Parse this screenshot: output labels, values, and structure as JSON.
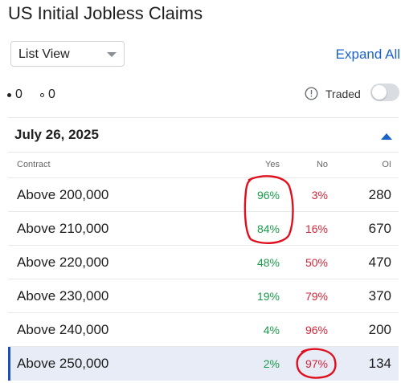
{
  "page": {
    "title": "US Initial Jobless Claims"
  },
  "controls": {
    "view_select": "List View",
    "expand_all": "Expand All",
    "filled_count": "0",
    "ring_count": "0",
    "traded_label": "Traded",
    "traded_toggle_on": false
  },
  "section": {
    "date": "July 26, 2025"
  },
  "table": {
    "headers": {
      "contract": "Contract",
      "yes": "Yes",
      "no": "No",
      "oi": "OI"
    },
    "rows": [
      {
        "contract": "Above 200,000",
        "yes": "96%",
        "no": "3%",
        "oi": "280"
      },
      {
        "contract": "Above 210,000",
        "yes": "84%",
        "no": "16%",
        "oi": "670"
      },
      {
        "contract": "Above 220,000",
        "yes": "48%",
        "no": "50%",
        "oi": "470"
      },
      {
        "contract": "Above 230,000",
        "yes": "19%",
        "no": "79%",
        "oi": "370"
      },
      {
        "contract": "Above 240,000",
        "yes": "4%",
        "no": "96%",
        "oi": "200"
      },
      {
        "contract": "Above 250,000",
        "yes": "2%",
        "no": "97%",
        "oi": "134"
      }
    ],
    "selected_row": "Above 250,000"
  },
  "colors": {
    "accent": "#1c63c8",
    "yes": "#1a9b4a",
    "no": "#d6263a",
    "annotation": "#e0101e",
    "selected_row_bg": "#e8ecf7"
  },
  "icons": {
    "dropdown": "chevron-down-icon",
    "info": "info-circle-icon",
    "collapse": "triangle-up-icon"
  }
}
